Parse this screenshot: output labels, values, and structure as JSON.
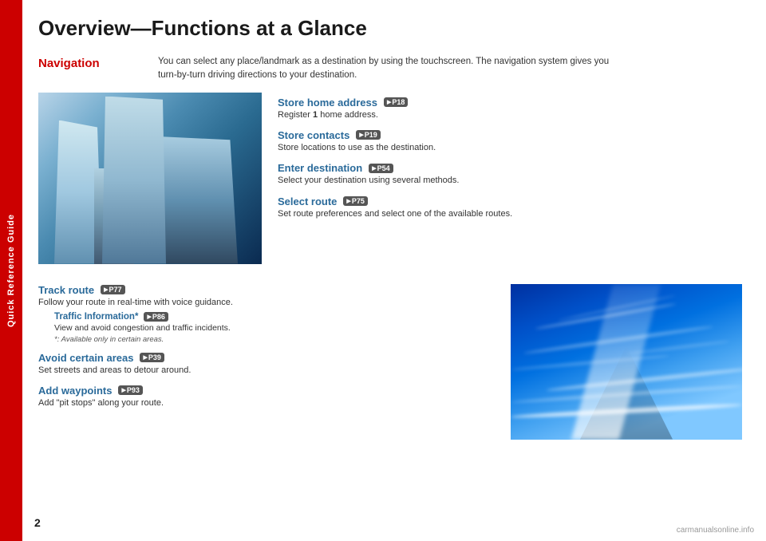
{
  "sidebar": {
    "label": "Quick Reference Guide"
  },
  "page": {
    "title": "Overview—Functions at a Glance",
    "number": "2"
  },
  "navigation": {
    "section_title": "Navigation",
    "description": "You can select any place/landmark as a destination by using the touchscreen. The navigation system gives you turn-by-turn driving directions to your destination.",
    "features": [
      {
        "id": "store-home",
        "title": "Store home address",
        "page_ref": "P18",
        "desc": "Register 1 home address."
      },
      {
        "id": "store-contacts",
        "title": "Store contacts",
        "page_ref": "P19",
        "desc": "Store locations to use as the destination."
      },
      {
        "id": "enter-destination",
        "title": "Enter destination",
        "page_ref": "P54",
        "desc": "Select your destination using several methods."
      },
      {
        "id": "select-route",
        "title": "Select route",
        "page_ref": "P75",
        "desc": "Set route preferences and select one of the available routes."
      }
    ],
    "bottom_features": [
      {
        "id": "track-route",
        "title": "Track route",
        "page_ref": "P77",
        "desc": "Follow your route in real-time with voice guidance.",
        "sub": {
          "title": "Traffic Information*",
          "page_ref": "P86",
          "desc": "View and avoid congestion and traffic incidents.",
          "note": "*: Available only in certain areas."
        }
      },
      {
        "id": "avoid-areas",
        "title": "Avoid certain areas",
        "page_ref": "P39",
        "desc": "Set streets and areas to detour around."
      },
      {
        "id": "add-waypoints",
        "title": "Add waypoints",
        "page_ref": "P93",
        "desc": "Add \"pit stops\" along your route."
      }
    ]
  },
  "watermark": "carmanualsonline.info"
}
